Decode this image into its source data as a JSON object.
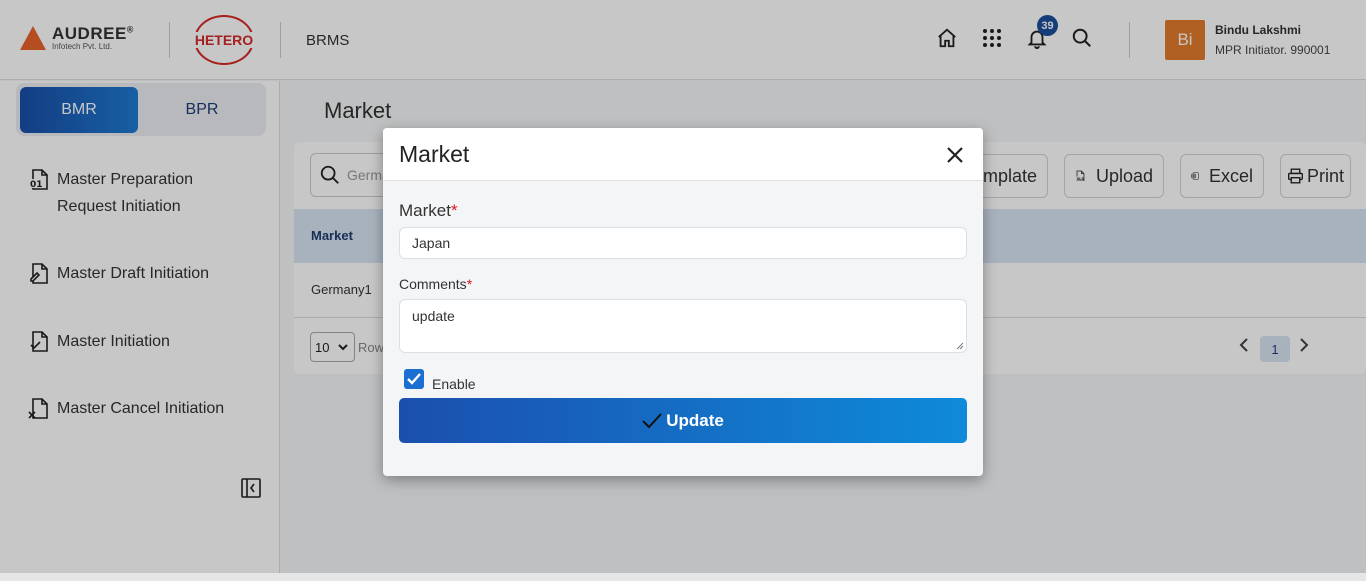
{
  "header": {
    "company_name": "AUDREE",
    "company_registered": "®",
    "company_sub": "Infotech Pvt. Ltd.",
    "partner_logo": "HETERO",
    "app_name": "BRMS",
    "notification_count": "39",
    "icons": [
      "home-icon",
      "apps-grid-icon",
      "bell-icon",
      "search-icon"
    ],
    "user": {
      "initials": "Bi",
      "name": "Bindu Lakshmi",
      "role": "MPR Initiator. 990001",
      "avatar_color": "#e07b2c"
    }
  },
  "sidebar": {
    "tabs": [
      {
        "label": "BMR",
        "active": true
      },
      {
        "label": "BPR",
        "active": false
      }
    ],
    "items": [
      {
        "label_line1": "Master Preparation",
        "label_line2": "Request Initiation"
      },
      {
        "label_line1": "Master Draft Initiation"
      },
      {
        "label_line1": "Master Initiation"
      },
      {
        "label_line1": "Master Cancel Initiation"
      }
    ]
  },
  "main": {
    "title": "Market",
    "search_value": "Germa",
    "toolbar": {
      "template_label": "emplate",
      "upload_label": "Upload",
      "excel_label": "Excel",
      "print_label": "Print"
    },
    "table": {
      "header": "Market",
      "rows": [
        "Germany1"
      ]
    },
    "pager": {
      "page_size": "10",
      "rows_label": "Row",
      "current_page": "1"
    }
  },
  "modal": {
    "title": "Market",
    "market_label": "Market",
    "market_value": "Japan",
    "comments_label": "Comments",
    "comments_value": "update",
    "required_mark": "*",
    "enable_label": "Enable",
    "enable_checked": true,
    "submit_label": "Update",
    "accent": "#1a6fd0"
  }
}
